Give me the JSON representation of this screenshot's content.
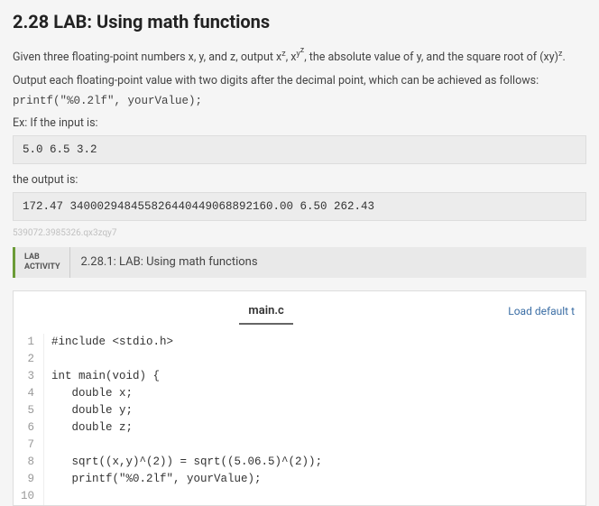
{
  "title": "2.28 LAB: Using math functions",
  "desc_prefix": "Given three floating-point numbers x, y, and z, output x",
  "desc_mid1": ", x",
  "desc_mid2": ", the absolute value of y, and the square root of (xy)",
  "desc_suffix": ".",
  "desc_line2": "Output each floating-point value with two digits after the decimal point, which can be achieved as follows:",
  "printf_example": "printf(\"%0.2lf\", yourValue);",
  "ex_if_input": "Ex: If the input is:",
  "input_sample": "5.0 6.5 3.2",
  "output_is": "the output is:",
  "output_sample": "172.47 340002948455826440449068892160.00 6.50 262.43",
  "watermark": "539072.3985326.qx3zqy7",
  "badge_line1": "LAB",
  "badge_line2": "ACTIVITY",
  "activity_title": "2.28.1: LAB: Using math functions",
  "file_tab": "main.c",
  "load_default": "Load default t",
  "code": {
    "l1": "#include <stdio.h>",
    "l2": "",
    "l3": "int main(void) {",
    "l4": "   double x;",
    "l5": "   double y;",
    "l6": "   double z;",
    "l7": "",
    "l8": "   sqrt((x,y)^(2)) = sqrt((5.06.5)^(2));",
    "l9": "   printf(\"%0.2lf\", yourValue);",
    "l10": ""
  },
  "line_numbers": [
    "1",
    "2",
    "3",
    "4",
    "5",
    "6",
    "7",
    "8",
    "9",
    "10"
  ]
}
